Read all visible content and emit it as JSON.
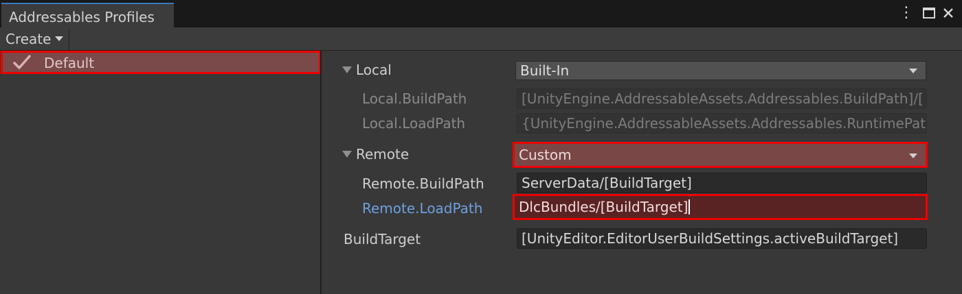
{
  "window": {
    "tab_title": "Addressables Profiles",
    "menu_icon": "kebab-menu-icon",
    "maximize_icon": "maximize-icon",
    "close_icon": "close-icon"
  },
  "toolbar": {
    "create_label": "Create"
  },
  "profiles": [
    {
      "label": "Default",
      "selected": true,
      "icon": "check-icon"
    }
  ],
  "properties": {
    "local": {
      "label": "Local",
      "dropdown_value": "Built-In",
      "build_path_label": "Local.BuildPath",
      "build_path_value": "[UnityEngine.AddressableAssets.Addressables.BuildPath]/[",
      "load_path_label": "Local.LoadPath",
      "load_path_value": "{UnityEngine.AddressableAssets.Addressables.RuntimePat"
    },
    "remote": {
      "label": "Remote",
      "dropdown_value": "Custom",
      "build_path_label": "Remote.BuildPath",
      "build_path_value": "ServerData/[BuildTarget]",
      "load_path_label": "Remote.LoadPath",
      "load_path_value": "DlcBundles/[BuildTarget]"
    },
    "build_target": {
      "label": "BuildTarget",
      "value": "[UnityEditor.EditorUserBuildSettings.activeBuildTarget]"
    }
  },
  "colors": {
    "highlight": "#ee0000",
    "selected_row": "#7a4a4a",
    "tab_accent": "#3a79bb",
    "modified_label": "#6fa0df"
  }
}
